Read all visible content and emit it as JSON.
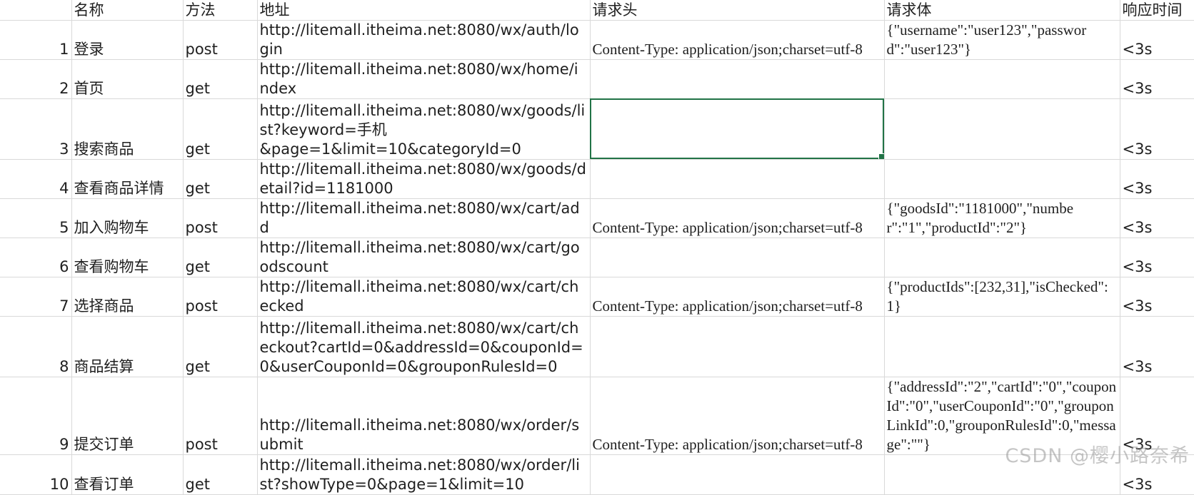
{
  "columns": [
    "名称",
    "方法",
    "地址",
    "请求头",
    "请求体",
    "响应时间"
  ],
  "rows": [
    {
      "num": "1",
      "name": "登录",
      "method": "post",
      "url": "http://litemall.itheima.net:8080/wx/auth/login",
      "header": "Content-Type: application/json;charset=utf-8",
      "body": "{\"username\":\"user123\",\"password\":\"user123\"}",
      "time": "<3s"
    },
    {
      "num": "2",
      "name": "首页",
      "method": "get",
      "url": "http://litemall.itheima.net:8080/wx/home/index",
      "header": "",
      "body": "",
      "time": "<3s"
    },
    {
      "num": "3",
      "name": "搜索商品",
      "method": "get",
      "url": "http://litemall.itheima.net:8080/wx/goods/list?keyword=手机\n&page=1&limit=10&categoryId=0",
      "header": "",
      "body": "",
      "time": "<3s"
    },
    {
      "num": "4",
      "name": "查看商品详情",
      "method": "get",
      "url": "http://litemall.itheima.net:8080/wx/goods/detail?id=1181000",
      "header": "",
      "body": "",
      "time": "<3s"
    },
    {
      "num": "5",
      "name": "加入购物车",
      "method": "post",
      "url": "http://litemall.itheima.net:8080/wx/cart/add",
      "header": "Content-Type: application/json;charset=utf-8",
      "body": "{\"goodsId\":\"1181000\",\"number\":\"1\",\"productId\":\"2\"}",
      "time": "<3s"
    },
    {
      "num": "6",
      "name": "查看购物车",
      "method": "get",
      "url": "http://litemall.itheima.net:8080/wx/cart/goodscount",
      "header": "",
      "body": "",
      "time": "<3s"
    },
    {
      "num": "7",
      "name": "选择商品",
      "method": "post",
      "url": "http://litemall.itheima.net:8080/wx/cart/checked",
      "header": "Content-Type: application/json;charset=utf-8",
      "body": "{\"productIds\":[232,31],\"isChecked\":1}",
      "time": "<3s"
    },
    {
      "num": "8",
      "name": "商品结算",
      "method": "get",
      "url": "http://litemall.itheima.net:8080/wx/cart/checkout?cartId=0&addressId=0&couponId=0&userCouponId=0&grouponRulesId=0",
      "header": "",
      "body": "",
      "time": "<3s"
    },
    {
      "num": "9",
      "name": "提交订单",
      "method": "post",
      "url": "http://litemall.itheima.net:8080/wx/order/submit",
      "header": "Content-Type: application/json;charset=utf-8",
      "body": "{\"addressId\":\"2\",\"cartId\":\"0\",\"couponId\":\"0\",\"userCouponId\":\"0\",\"grouponLinkId\":0,\"grouponRulesId\":0,\"message\":\"\"}",
      "time": "<3s"
    },
    {
      "num": "10",
      "name": "查看订单",
      "method": "get",
      "url": "http://litemall.itheima.net:8080/wx/order/list?showType=0&page=1&limit=10",
      "header": "",
      "body": "",
      "time": "<3s"
    }
  ],
  "watermark": "CSDN @樱小路奈希",
  "accent_color": "#217346"
}
